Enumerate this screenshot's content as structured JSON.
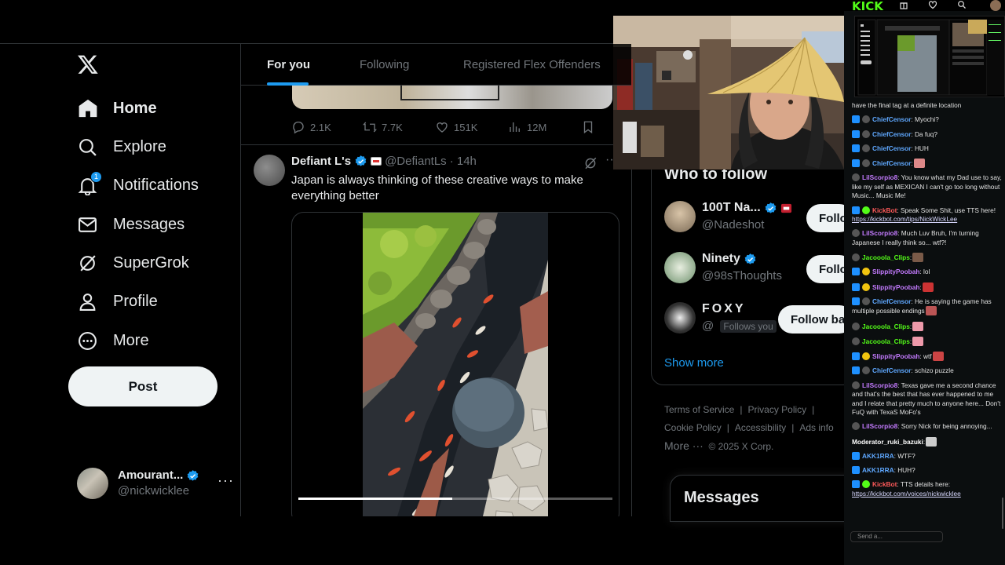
{
  "x_nav": {
    "items": [
      {
        "label": "Home",
        "icon": "home-icon",
        "active": true
      },
      {
        "label": "Explore",
        "icon": "search-icon"
      },
      {
        "label": "Notifications",
        "icon": "bell-icon",
        "badge": "1"
      },
      {
        "label": "Messages",
        "icon": "envelope-icon"
      },
      {
        "label": "SuperGrok",
        "icon": "grok-icon"
      },
      {
        "label": "Profile",
        "icon": "person-icon"
      },
      {
        "label": "More",
        "icon": "more-circle-icon"
      }
    ],
    "post_label": "Post",
    "account": {
      "display_name": "Amourant...",
      "handle": "@nickwicklee"
    }
  },
  "tabs": [
    "For you",
    "Following",
    "Registered Flex Offenders"
  ],
  "prev_tweet_stats": {
    "replies": "2.1K",
    "reposts": "7.7K",
    "likes": "151K",
    "views": "12M"
  },
  "tweet": {
    "display_name": "Defiant L's",
    "handle": "@DefiantLs",
    "time": "· 14h",
    "text": "Japan is always thinking of these creative ways to make everything better",
    "video_progress": 0.49
  },
  "who_to_follow": {
    "title": "Who to follow",
    "accounts": [
      {
        "display_name": "100T Na...",
        "handle": "@Nadeshot",
        "button": "Follo"
      },
      {
        "display_name": "Ninety",
        "handle": "@98sThoughts",
        "button": "Follo"
      },
      {
        "display_name": "FOXY",
        "handle": "@",
        "follows_you": "Follows you",
        "button": "Follow bac"
      }
    ],
    "show_more": "Show more"
  },
  "footer": {
    "links": [
      "Terms of Service",
      "Privacy Policy",
      "Cookie Policy",
      "Accessibility",
      "Ads info",
      "More ···"
    ],
    "copyright": "© 2025 X Corp."
  },
  "messages_drawer": "Messages",
  "kick": {
    "logo": "KICK",
    "chat": [
      {
        "user": "",
        "text": "have the final tag at a definite location",
        "color": "white",
        "badges": []
      },
      {
        "user": "ChiefCensor",
        "text": ": Myochi?",
        "color": "blue",
        "badges": [
          "mod",
          "usr"
        ]
      },
      {
        "user": "ChiefCensor",
        "text": ": Da fuq?",
        "color": "blue",
        "badges": [
          "mod",
          "usr"
        ]
      },
      {
        "user": "ChiefCensor",
        "text": ": HUH",
        "color": "blue",
        "badges": [
          "mod",
          "usr"
        ]
      },
      {
        "user": "ChiefCensor",
        "text": ":",
        "color": "blue",
        "badges": [
          "mod",
          "usr"
        ],
        "emote": "#d88"
      },
      {
        "user": "LilScorpio8",
        "text": ": You know what my Dad use to say, like my self as MEXICAN I can't go too long without Music... Music Me!",
        "color": "purple",
        "badges": [
          "usr"
        ]
      },
      {
        "user": "KickBot",
        "text": ": Speak Some Shit, use TTS here! ",
        "color": "red",
        "badges": [
          "mod",
          "bot"
        ],
        "link": "https://kickbot.com/tips/NickWickLee"
      },
      {
        "user": "LilScorpio8",
        "text": ": Much Luv Bruh, I'm turning Japanese I really think so... wtf?!",
        "color": "purple",
        "badges": [
          "usr"
        ]
      },
      {
        "user": "Jacooola_Clips",
        "text": ":",
        "color": "green",
        "badges": [
          "usr"
        ],
        "emote": "#7a5a48"
      },
      {
        "user": "SlippityPoobah",
        "text": ": lol",
        "color": "purple",
        "badges": [
          "mod",
          "sub"
        ]
      },
      {
        "user": "SlippityPoobah",
        "text": ":",
        "color": "purple",
        "badges": [
          "mod",
          "sub"
        ],
        "emote": "#c33"
      },
      {
        "user": "ChiefCensor",
        "text": ": He is saying the game has multiple possible endings",
        "color": "blue",
        "badges": [
          "mod",
          "usr"
        ],
        "emote": "#b55"
      },
      {
        "user": "Jacooola_Clips",
        "text": ":",
        "color": "green",
        "badges": [
          "usr"
        ],
        "emote": "#e9a"
      },
      {
        "user": "Jacooola_Clips",
        "text": ":",
        "color": "green",
        "badges": [
          "usr"
        ],
        "emote": "#e9a"
      },
      {
        "user": "SlippityPoobah",
        "text": ": wtf",
        "color": "purple",
        "badges": [
          "mod",
          "sub"
        ],
        "emote": "#c44"
      },
      {
        "user": "ChiefCensor",
        "text": ": schizo puzzle",
        "color": "blue",
        "badges": [
          "mod",
          "usr"
        ]
      },
      {
        "user": "LilScorpio8",
        "text": ": Texas gave me a second chance and that's the best that has ever happened to me and I relate that pretty much to anyone here... Don't FuQ with TexaS MoFo's",
        "color": "purple",
        "badges": [
          "usr"
        ]
      },
      {
        "user": "LilScorpio8",
        "text": ": Sorry Nick for being annoying...",
        "color": "purple",
        "badges": [
          "usr"
        ]
      },
      {
        "user": "Moderator_ruki_bazuki",
        "text": ":",
        "color": "white",
        "badges": [],
        "emote": "#ccc"
      },
      {
        "user": "AKK1RRA",
        "text": ": WTF?",
        "color": "blue",
        "badges": [
          "mod"
        ]
      },
      {
        "user": "AKK1RRA",
        "text": ": HUH?",
        "color": "blue",
        "badges": [
          "mod"
        ]
      },
      {
        "user": "KickBot",
        "text": ": TTS details here: ",
        "color": "red",
        "badges": [
          "mod",
          "bot"
        ],
        "link": "https://kickbot.com/voices/nickwicklee"
      }
    ],
    "send_placeholder": "Send a..."
  }
}
